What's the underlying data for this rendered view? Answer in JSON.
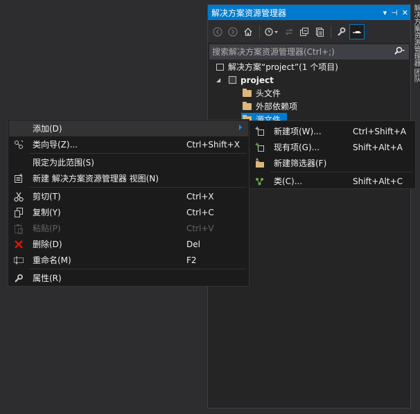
{
  "solution_explorer": {
    "title": "解决方案资源管理器",
    "title_buttons": [
      "▾",
      "⊣",
      "✕"
    ],
    "search_placeholder": "搜索解决方案资源管理器(Ctrl+;)",
    "tree": {
      "solution": "解决方案“project”(1 个项目)",
      "project": "project",
      "header_files": "头文件",
      "external_deps": "外部依赖项",
      "source_files": "源文件"
    }
  },
  "side_tabs": "解决方案资源管理器 团队",
  "context_menu": {
    "add": {
      "label": "添加(D)"
    },
    "class_wizard": {
      "label": "类向导(Z)...",
      "shortcut": "Ctrl+Shift+X"
    },
    "scope": {
      "label": "限定为此范围(S)"
    },
    "new_view": {
      "label": "新建 解决方案资源管理器 视图(N)"
    },
    "cut": {
      "label": "剪切(T)",
      "shortcut": "Ctrl+X"
    },
    "copy": {
      "label": "复制(Y)",
      "shortcut": "Ctrl+C"
    },
    "paste": {
      "label": "粘贴(P)",
      "shortcut": "Ctrl+V"
    },
    "delete": {
      "label": "删除(D)",
      "shortcut": "Del"
    },
    "rename": {
      "label": "重命名(M)",
      "shortcut": "F2"
    },
    "properties": {
      "label": "属性(R)"
    }
  },
  "add_submenu": {
    "new_item": {
      "label": "新建项(W)...",
      "shortcut": "Ctrl+Shift+A"
    },
    "existing_item": {
      "label": "现有项(G)...",
      "shortcut": "Shift+Alt+A"
    },
    "new_filter": {
      "label": "新建筛选器(F)"
    },
    "class": {
      "label": "类(C)...",
      "shortcut": "Shift+Alt+C"
    }
  },
  "colors": {
    "accent": "#007acc",
    "menu_bg": "#1b1b1c",
    "panel_bg": "#252526",
    "delete_red": "#e51400"
  }
}
